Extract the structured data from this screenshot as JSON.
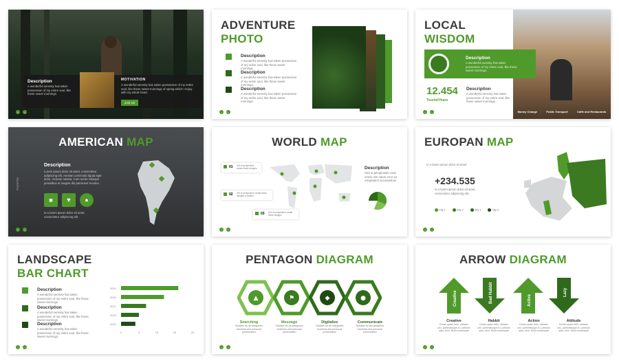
{
  "accent": "#4f9a2b",
  "dark_accent": "#2f6a1c",
  "lorem_short": "A wonderful serenity has taken possession of my entire soul, like these sweet mornings.",
  "lorem_long": "A wonderful serenity has taken possession of my entire soul, like these sweet mornings of spring which I enjoy with my whole heart.",
  "slide1": {
    "desc_title": "Description",
    "motivation_title": "MOTIVATION",
    "join_label": "Join Us"
  },
  "slide2": {
    "title_dark": "ADVENTURE",
    "title_green": "PHOTO",
    "items": [
      "Description",
      "Description",
      "Description"
    ]
  },
  "slide3": {
    "title_dark": "LOCAL",
    "title_green": "WISDOM",
    "banner_title": "Description",
    "stat_value": "12.454",
    "stat_label": "Tourist/Years",
    "stat_desc_title": "Description",
    "captions": [
      "Money Change",
      "Public Transport",
      "Caffe and Restaurants"
    ]
  },
  "slide4": {
    "title_white": "AMERICAN",
    "title_green": "MAP",
    "desc_title": "Description",
    "side_label": "Bogota Map",
    "desc_body": "Lorem ipsum dolor sit amet, consectetur adipiscing elit. Aenean commodo ligula eget dolor. Aenean massa. Cum sociis natoque penatibus et magnis dis parturient montes.",
    "foot_body": "Is a lorem ipsum dolor sit amet, consectetur adipiscing elit.",
    "icons": [
      "car-icon",
      "basket-icon",
      "pin-icon"
    ]
  },
  "slide5": {
    "title_dark": "WORLD",
    "title_green": "MAP",
    "callouts": [
      {
        "num": "01",
        "text": "Set of perspective create these designs"
      },
      {
        "num": "02",
        "text": "Set of perspective create these designs in rhythm"
      },
      {
        "num": "03",
        "text": "Set of perspective create these designs"
      }
    ],
    "desc_title": "Description",
    "desc_body": "Sed ut perspiciatis unde omnis iste natus error sit voluptatem accusantium"
  },
  "slide6": {
    "title_dark": "EUROPAN",
    "title_green": "MAP",
    "intro": "Is a lorem ipsum dolor sit amet",
    "stat_value": "+234.535",
    "stat_desc": "Is a lorem ipsum dolor sit amet, consectetur adipiscing elit.",
    "cities": [
      "City 1",
      "City 2",
      "City 3",
      "City 4"
    ]
  },
  "slide7": {
    "title_line1": "LANDSCAPE",
    "title_line2": "BAR CHART",
    "items": [
      "Description",
      "Description",
      "Description"
    ],
    "year_labels": [
      "2015",
      "2016",
      "2017",
      "2018",
      "2019"
    ],
    "x_ticks": [
      "0",
      "5",
      "10",
      "15",
      "20"
    ]
  },
  "slide8": {
    "title_dark": "PENTAGON",
    "title_green": "DIAGRAM",
    "steps": [
      "Searching",
      "Message",
      "Digitalize",
      "Communicate"
    ],
    "step_desc": "Suitable for all categories business and personal presentation"
  },
  "slide9": {
    "title_dark": "ARROW",
    "title_green": "DIAGRAM",
    "arrows": [
      {
        "word": "Creative",
        "dir": "up"
      },
      {
        "word": "Bad Habbit",
        "dir": "down"
      },
      {
        "word": "Active",
        "dir": "up"
      },
      {
        "word": "Lazy",
        "dir": "down"
      }
    ],
    "labels": [
      "Creative",
      "Habbit",
      "Action",
      "Attitude"
    ],
    "label_desc": "Donec quam felis, ultricies nec, pellentesque eu, pretium quis, sem. Nulla consequat"
  },
  "chart_data": {
    "type": "bar",
    "orientation": "horizontal",
    "title": "LANDSCAPE BAR CHART",
    "categories": [
      "2015",
      "2016",
      "2017",
      "2018",
      "2019"
    ],
    "series": [
      {
        "values": [
          16,
          12,
          7,
          5,
          4
        ]
      }
    ],
    "xlim": [
      0,
      20
    ],
    "x_ticks": [
      0,
      5,
      10,
      15,
      20
    ],
    "grid": false
  }
}
